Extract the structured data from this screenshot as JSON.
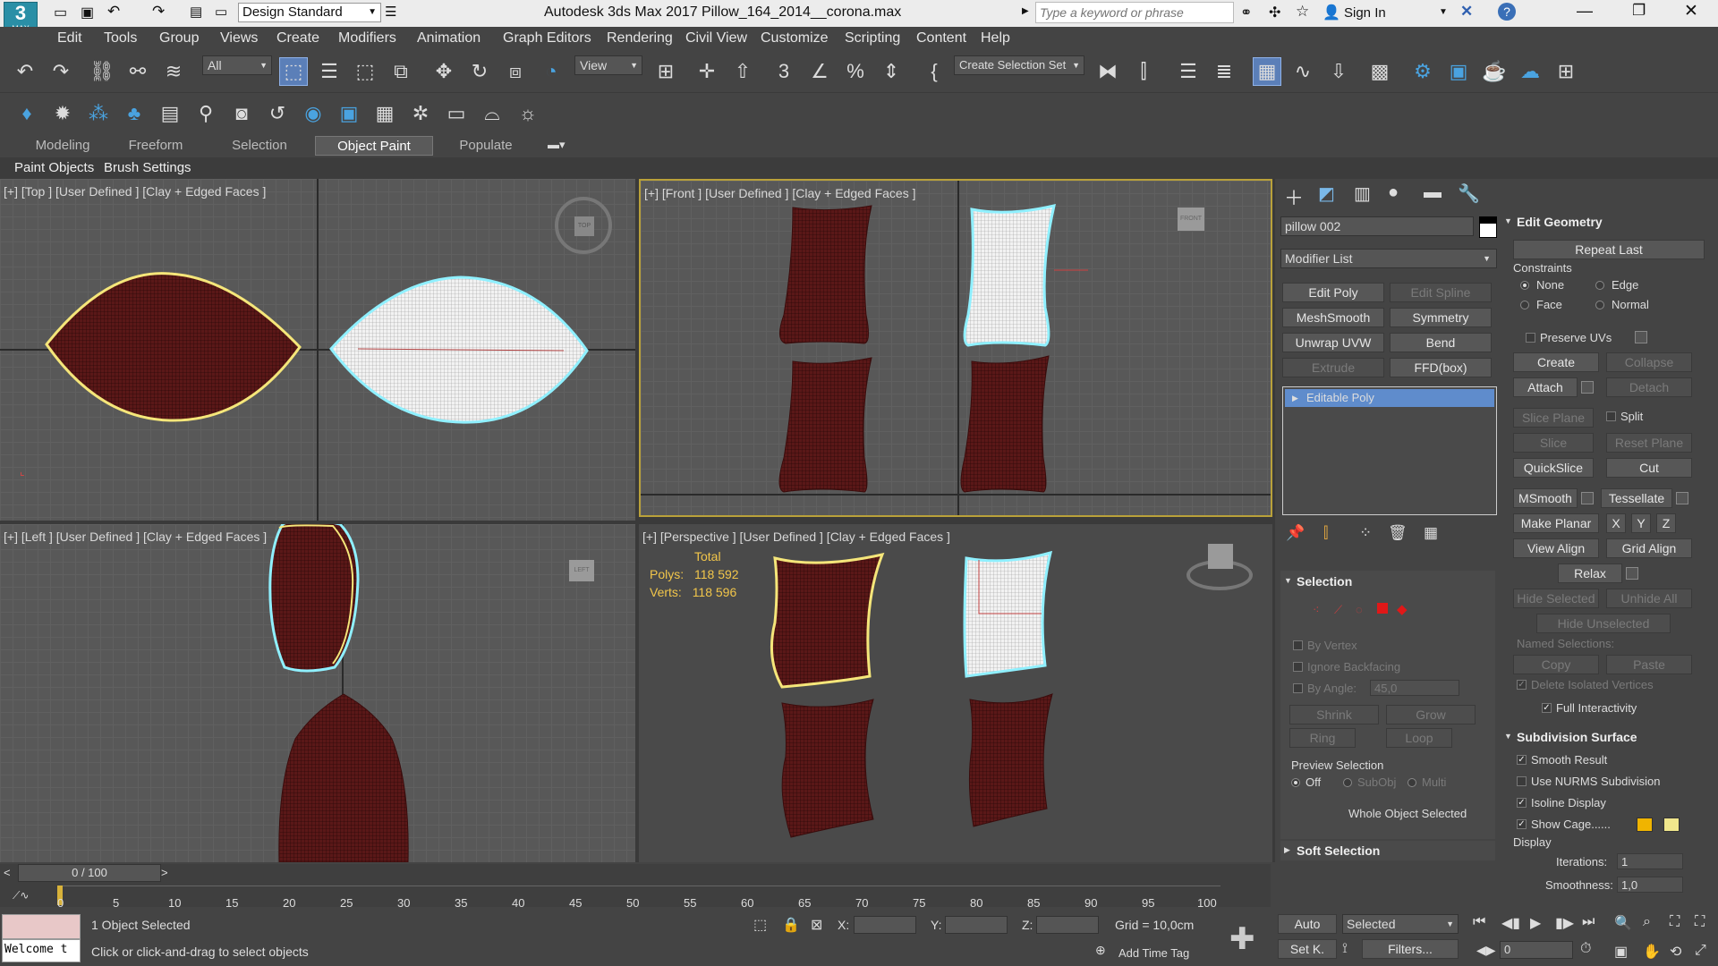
{
  "window": {
    "app_title": "Autodesk 3ds Max 2017",
    "file_title": "Pillow_164_2014__corona.max",
    "workspace": "Design Standard",
    "search_placeholder": "Type a keyword or phrase",
    "sign_in": "Sign In",
    "logo": "3",
    "logo_sub": "MAX"
  },
  "menu": [
    "Edit",
    "Tools",
    "Group",
    "Views",
    "Create",
    "Modifiers",
    "Animation",
    "Graph Editors",
    "Rendering",
    "Civil View",
    "Customize",
    "Scripting",
    "Content",
    "Help"
  ],
  "toolbar": {
    "filter": "All",
    "ref_coord": "View",
    "selection_set": "Create Selection Set"
  },
  "ribbon": {
    "tabs": [
      "Modeling",
      "Freeform",
      "Selection",
      "Object Paint",
      "Populate"
    ],
    "active_tab": "Object Paint",
    "subtabs": [
      "Paint Objects",
      "Brush Settings"
    ]
  },
  "viewports": {
    "top": "[+] [Top ] [User Defined ] [Clay + Edged Faces ]",
    "front": "[+] [Front ] [User Defined ] [Clay + Edged Faces ]",
    "left": "[+] [Left ] [User Defined ] [Clay + Edged Faces ]",
    "perspective": "[+] [Perspective ] [User Defined ] [Clay + Edged Faces ]"
  },
  "stats": {
    "total_label": "Total",
    "polys_label": "Polys:",
    "polys": "118 592",
    "verts_label": "Verts:",
    "verts": "118 596"
  },
  "viewcube": {
    "top": "TOP",
    "front": "FRONT",
    "left": "LEFT"
  },
  "command_panel": {
    "object_name": "pillow 002",
    "modifier_list": "Modifier List",
    "buttons": [
      "Edit Poly",
      "Edit Spline",
      "MeshSmooth",
      "Symmetry",
      "Unwrap UVW",
      "Bend",
      "Extrude",
      "FFD(box)"
    ],
    "stack_item": "Editable Poly"
  },
  "selection": {
    "title": "Selection",
    "by_vertex": "By Vertex",
    "ignore_backfacing": "Ignore Backfacing",
    "by_angle": "By Angle:",
    "angle_value": "45,0",
    "shrink": "Shrink",
    "grow": "Grow",
    "ring": "Ring",
    "loop": "Loop",
    "preview_title": "Preview Selection",
    "off": "Off",
    "subobj": "SubObj",
    "multi": "Multi",
    "whole_object": "Whole Object Selected"
  },
  "soft_selection": {
    "title": "Soft Selection"
  },
  "edit_geometry": {
    "title": "Edit Geometry",
    "repeat_last": "Repeat Last",
    "constraints": "Constraints",
    "none": "None",
    "edge": "Edge",
    "face": "Face",
    "normal": "Normal",
    "preserve_uvs": "Preserve UVs",
    "create": "Create",
    "collapse": "Collapse",
    "attach": "Attach",
    "detach": "Detach",
    "slice_plane": "Slice Plane",
    "split": "Split",
    "slice": "Slice",
    "reset_plane": "Reset Plane",
    "quickslice": "QuickSlice",
    "cut": "Cut",
    "msmooth": "MSmooth",
    "tessellate": "Tessellate",
    "make_planar": "Make Planar",
    "x": "X",
    "y": "Y",
    "z": "Z",
    "view_align": "View Align",
    "grid_align": "Grid Align",
    "relax": "Relax",
    "hide_selected": "Hide Selected",
    "unhide_all": "Unhide All",
    "hide_unselected": "Hide Unselected",
    "named_selections": "Named Selections:",
    "copy": "Copy",
    "paste": "Paste",
    "delete_isolated": "Delete Isolated Vertices",
    "full_interactivity": "Full Interactivity"
  },
  "subdivision": {
    "title": "Subdivision Surface",
    "smooth_result": "Smooth Result",
    "use_nurms": "Use NURMS Subdivision",
    "isoline": "Isoline Display",
    "show_cage": "Show Cage......",
    "display": "Display",
    "iterations_label": "Iterations:",
    "iterations": "1",
    "smoothness_label": "Smoothness:",
    "smoothness": "1,0"
  },
  "timeline": {
    "frame": "0 / 100",
    "ticks": [
      "0",
      "5",
      "10",
      "15",
      "20",
      "25",
      "30",
      "35",
      "40",
      "45",
      "50",
      "55",
      "60",
      "65",
      "70",
      "75",
      "80",
      "85",
      "90",
      "95",
      "100"
    ]
  },
  "status": {
    "selected": "1 Object Selected",
    "prompt": "Click or click-and-drag to select objects",
    "welcome": "Welcome t",
    "x_label": "X:",
    "y_label": "Y:",
    "z_label": "Z:",
    "grid": "Grid = 10,0cm",
    "add_time_tag": "Add Time Tag",
    "auto": "Auto",
    "set_key": "Set K.",
    "selected_dropdown": "Selected",
    "filters": "Filters...",
    "frame_value": "0"
  },
  "colors": {
    "pillow_dark": "#5e1a1a",
    "selection_yellow": "#f5e67a",
    "selection_cyan": "#8ff0ff",
    "accent": "#5b7fb8",
    "cage_orange": "#f0b400",
    "cage_yellow": "#f0e68c"
  }
}
